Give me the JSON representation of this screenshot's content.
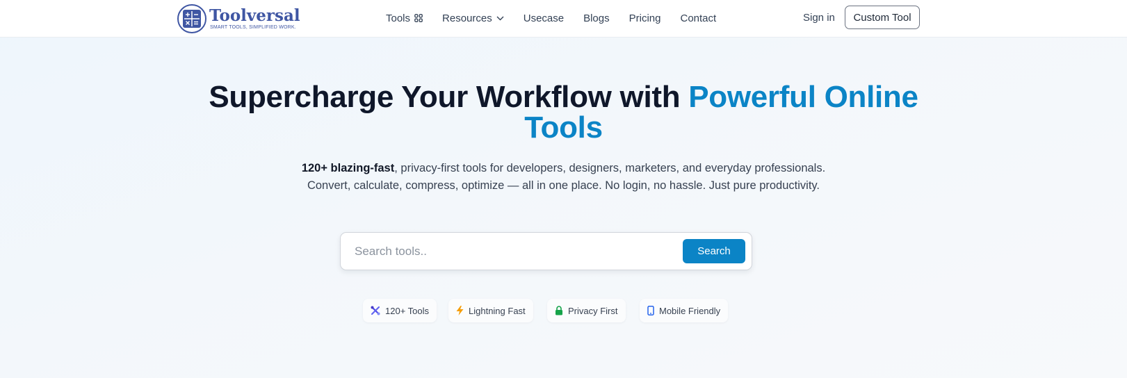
{
  "brand": {
    "name": "Toolversal",
    "tagline": "SMART TOOLS, SIMPLIFIED WORK.",
    "color": "#3f56a3"
  },
  "nav": {
    "items": [
      {
        "label": "Tools",
        "icon": "grid-icon"
      },
      {
        "label": "Resources",
        "icon": "chevron-down-icon"
      },
      {
        "label": "Usecase"
      },
      {
        "label": "Blogs"
      },
      {
        "label": "Pricing"
      },
      {
        "label": "Contact"
      }
    ],
    "signin": "Sign in",
    "cta": "Custom Tool"
  },
  "hero": {
    "title_main": "Supercharge Your Workflow with ",
    "title_accent": "Powerful Online Tools",
    "accent_color": "#0b84c6",
    "subtitle_bold": "120+ blazing-fast",
    "subtitle_rest": ", privacy-first tools for developers, designers, marketers, and everyday professionals. Convert, calculate, compress, optimize — all in one place. No login, no hassle. Just pure productivity."
  },
  "search": {
    "placeholder": "Search tools..",
    "value": "",
    "button": "Search"
  },
  "features": [
    {
      "label": "120+ Tools",
      "icon": "tools-icon"
    },
    {
      "label": "Lightning Fast",
      "icon": "lightning-icon"
    },
    {
      "label": "Privacy First",
      "icon": "lock-icon"
    },
    {
      "label": "Mobile Friendly",
      "icon": "mobile-icon"
    }
  ]
}
